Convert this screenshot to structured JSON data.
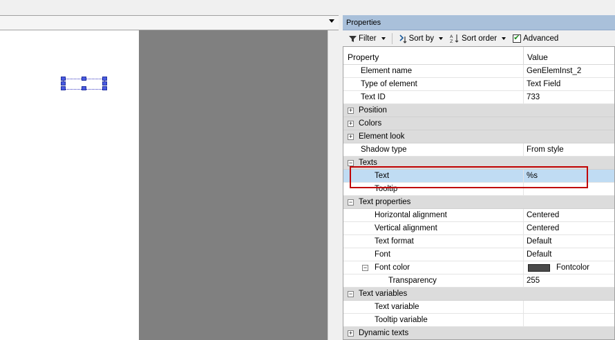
{
  "properties_panel": {
    "title": "Properties",
    "toolbar": {
      "filter_label": "Filter",
      "sortby_label": "Sort by",
      "sortorder_label": "Sort order",
      "advanced_label": "Advanced",
      "advanced_checked": true
    },
    "columns": {
      "property": "Property",
      "value": "Value"
    },
    "rows": [
      {
        "label": "Element name",
        "value": "GenElemInst_2"
      },
      {
        "label": "Type of element",
        "value": "Text Field"
      },
      {
        "label": "Text ID",
        "value": "733"
      },
      {
        "label": "Position",
        "expander": "+"
      },
      {
        "label": "Colors",
        "expander": "+"
      },
      {
        "label": "Element look",
        "expander": "+"
      },
      {
        "label": "Shadow type",
        "value": "From style"
      },
      {
        "label": "Texts",
        "expander": "−"
      },
      {
        "label": "Text",
        "value": "%s",
        "selected": true
      },
      {
        "label": "Tooltip",
        "value": ""
      },
      {
        "label": "Text properties",
        "expander": "−"
      },
      {
        "label": "Horizontal alignment",
        "value": "Centered"
      },
      {
        "label": "Vertical alignment",
        "value": "Centered"
      },
      {
        "label": "Text format",
        "value": "Default"
      },
      {
        "label": "Font",
        "value": "Default"
      },
      {
        "label": "Font color",
        "value": "Fontcolor",
        "expander": "−",
        "swatch_color": "#4a4a4a"
      },
      {
        "label": "Transparency",
        "value": "255"
      },
      {
        "label": "Text variables",
        "expander": "−"
      },
      {
        "label": "Text variable",
        "value": ""
      },
      {
        "label": "Tooltip variable",
        "value": ""
      },
      {
        "label": "Dynamic texts",
        "expander": "+"
      }
    ]
  },
  "colors": {
    "title_bar": "#a9c0da",
    "selection": "#c0dcf3",
    "highlight_box": "#c00000",
    "canvas_gray": "#808080"
  }
}
